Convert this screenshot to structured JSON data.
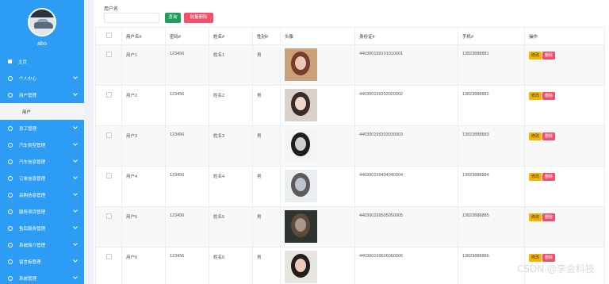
{
  "sidebar": {
    "username": "abo",
    "items": [
      {
        "label": "主页",
        "icon": "home-icon",
        "expandable": false,
        "active": false
      },
      {
        "label": "个人中心",
        "icon": "gear-icon",
        "expandable": true,
        "active": false
      },
      {
        "label": "用户管理",
        "icon": "gear-icon",
        "expandable": true,
        "active": true
      },
      {
        "label": "用户",
        "icon": "",
        "expandable": false,
        "sub": true
      },
      {
        "label": "员工管理",
        "icon": "gear-icon",
        "expandable": true
      },
      {
        "label": "汽车类型管理",
        "icon": "gear-icon",
        "expandable": true
      },
      {
        "label": "汽车信息管理",
        "icon": "gear-icon",
        "expandable": true
      },
      {
        "label": "订单信息管理",
        "icon": "gear-icon",
        "expandable": true
      },
      {
        "label": "采购信息管理",
        "icon": "gear-icon",
        "expandable": true
      },
      {
        "label": "服务项目管理",
        "icon": "gear-icon",
        "expandable": true
      },
      {
        "label": "售后服务管理",
        "icon": "gear-icon",
        "expandable": true
      },
      {
        "label": "系统简介管理",
        "icon": "gear-icon",
        "expandable": true
      },
      {
        "label": "留言板管理",
        "icon": "gear-icon",
        "expandable": true
      },
      {
        "label": "系统管理",
        "icon": "gear-icon",
        "expandable": true
      }
    ]
  },
  "search": {
    "label": "用户名",
    "value": "",
    "query_button": "查询",
    "batch_delete_button": "批量删除"
  },
  "table": {
    "headers": [
      "用户名#",
      "密码#",
      "姓名#",
      "性别#",
      "头像",
      "身份证#",
      "手机#",
      "操作"
    ],
    "edit_label": "修改",
    "delete_label": "删除",
    "rows": [
      {
        "username": "用户1",
        "password": "123456",
        "name": "姓名1",
        "gender": "男",
        "id_card": "440300199101010001",
        "phone": "13823888881"
      },
      {
        "username": "用户2",
        "password": "123456",
        "name": "姓名2",
        "gender": "男",
        "id_card": "440300199202020002",
        "phone": "13823888882"
      },
      {
        "username": "用户3",
        "password": "123456",
        "name": "姓名3",
        "gender": "男",
        "id_card": "440300199303030003",
        "phone": "13823888883"
      },
      {
        "username": "用户4",
        "password": "123456",
        "name": "姓名4",
        "gender": "男",
        "id_card": "440300199404040004",
        "phone": "13823888884"
      },
      {
        "username": "用户5",
        "password": "123456",
        "name": "姓名5",
        "gender": "男",
        "id_card": "440300199505050005",
        "phone": "13823888885"
      },
      {
        "username": "用户6",
        "password": "123456",
        "name": "姓名6",
        "gender": "男",
        "id_card": "440300199606060006",
        "phone": "13823888886"
      }
    ]
  },
  "watermark": "CSDN @李会科技",
  "colors": {
    "sidebar": "#2d9cf5",
    "query_button": "#1e9e5a",
    "danger": "#f0506e",
    "warning": "#f5b400"
  }
}
